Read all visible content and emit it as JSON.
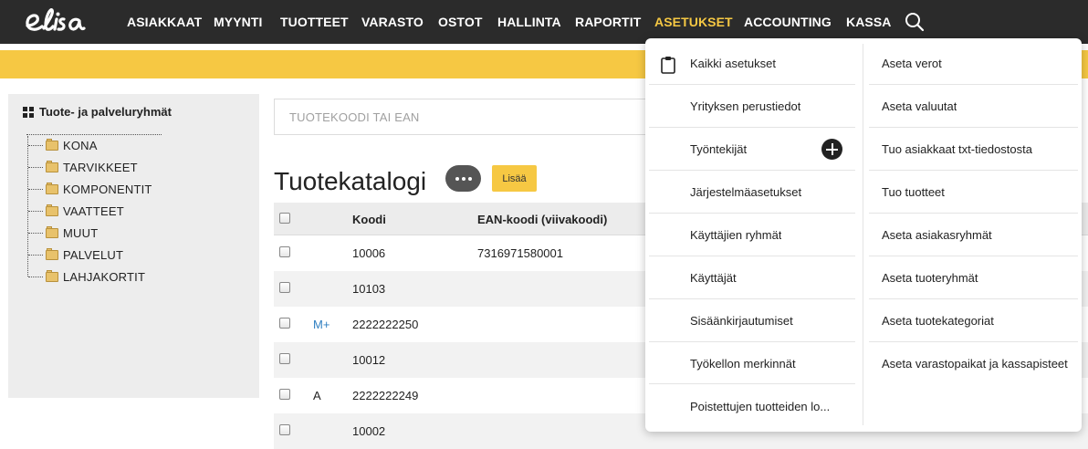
{
  "nav": {
    "logo_text": "elisa",
    "items": [
      "ASIAKKAAT",
      "MYYNTI",
      "TUOTTEET",
      "VARASTO",
      "OSTOT",
      "HALLINTA",
      "RAPORTIT",
      "ASETUKSET",
      "ACCOUNTING",
      "KASSA"
    ],
    "active": "ASETUKSET",
    "search_icon": "search-icon"
  },
  "colors": {
    "topbar": "#2b2b2b",
    "accent": "#f6c843",
    "link_blue": "#2f7fc1"
  },
  "tree": {
    "title": "Tuote- ja palveluryhmät",
    "items": [
      "KONA",
      "TARVIKKEET",
      "KOMPONENTIT",
      "VAATTEET",
      "MUUT",
      "PALVELUT",
      "LAHJAKORTIT"
    ]
  },
  "search": {
    "placeholder": "TUOTEKOODI TAI EAN",
    "value": ""
  },
  "catalog": {
    "title": "Tuotekatalogi",
    "add_label": "Lisää",
    "columns": [
      "Koodi",
      "EAN-koodi (viivakoodi)"
    ],
    "rows": [
      {
        "tag": "",
        "code": "10006",
        "ean": "7316971580001"
      },
      {
        "tag": "",
        "code": "10103",
        "ean": ""
      },
      {
        "tag": "M+",
        "code": "2222222250",
        "ean": ""
      },
      {
        "tag": "",
        "code": "10012",
        "ean": ""
      },
      {
        "tag": "A",
        "code": "2222222249",
        "ean": ""
      },
      {
        "tag": "",
        "code": "10002",
        "ean": ""
      }
    ]
  },
  "settings_menu": {
    "left": [
      "Kaikki asetukset",
      "Yrityksen perustiedot",
      "Työntekijät",
      "Järjestelmäasetukset",
      "Käyttäjien ryhmät",
      "Käyttäjät",
      "Sisäänkirjautumiset",
      "Työkellon merkinnät",
      "Poistettujen tuotteiden lo..."
    ],
    "right": [
      "Aseta verot",
      "Aseta valuutat",
      "Tuo asiakkaat txt-tiedostosta",
      "Tuo tuotteet",
      "Aseta asiakasryhmät",
      "Aseta tuoteryhmät",
      "Aseta tuotekategoriat",
      "Aseta varastopaikat ja kassapisteet"
    ]
  }
}
